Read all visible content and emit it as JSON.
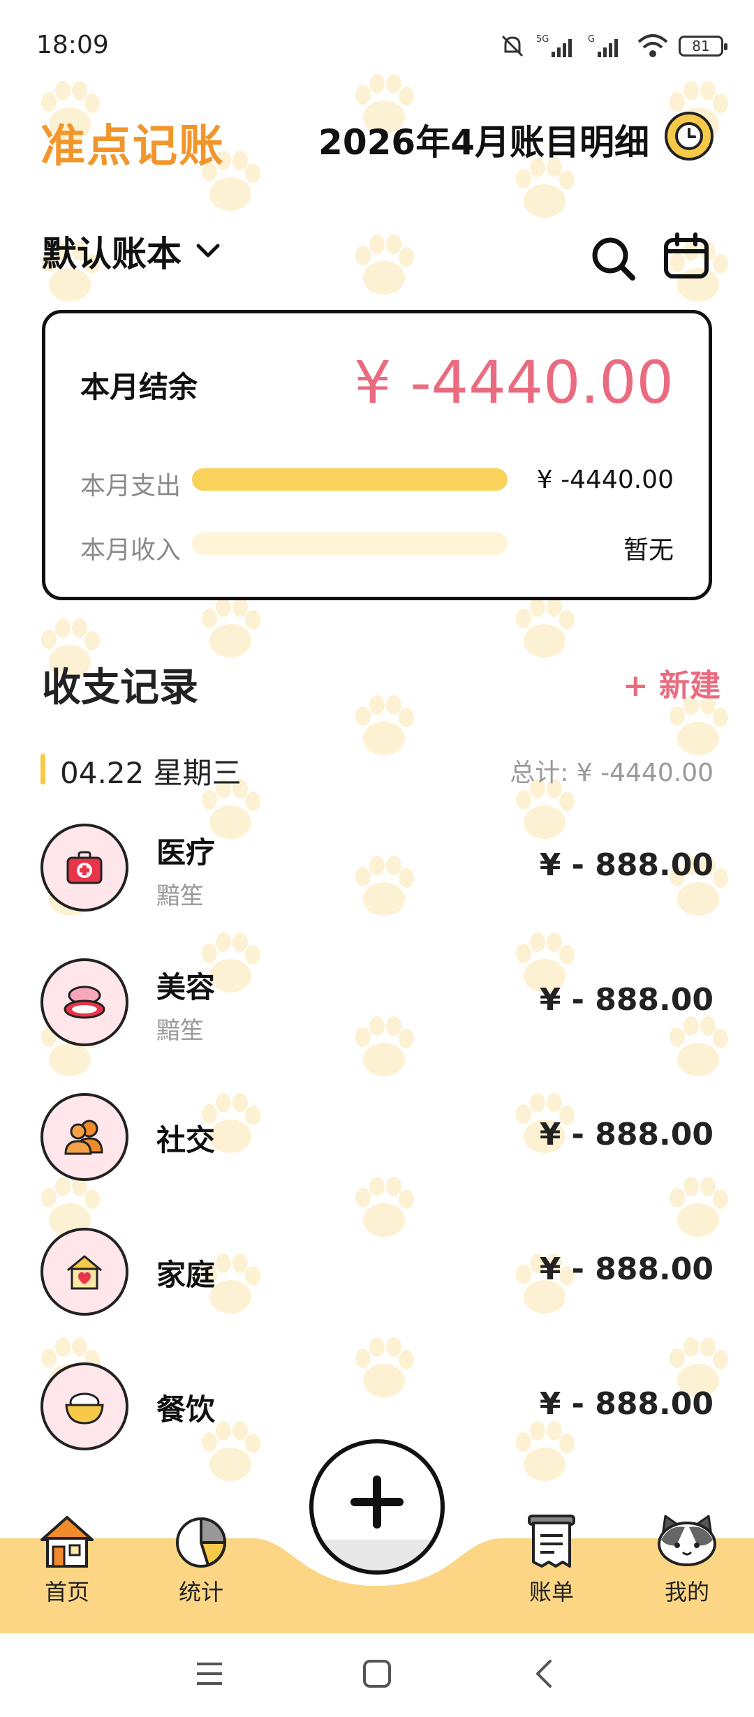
{
  "status_bar": {
    "time": "18:09",
    "battery": "81"
  },
  "header": {
    "app_title": "准点记账",
    "month_title": "2026年4月账目明细"
  },
  "book": {
    "name": "默认账本"
  },
  "summary": {
    "balance_label": "本月结余",
    "balance_value": "¥ -4440.00",
    "expense_label": "本月支出",
    "expense_value": "¥ -4440.00",
    "expense_ratio": 1.0,
    "income_label": "本月收入",
    "income_value": "暂无",
    "income_ratio": 0.0
  },
  "records": {
    "title": "收支记录",
    "new_label": "+ 新建",
    "date": "04.22 星期三",
    "day_total": "总计: ¥ -4440.00",
    "items": [
      {
        "category": "医疗",
        "note": "黯笙",
        "amount": "¥ - 888.00",
        "icon": "medical-kit-icon"
      },
      {
        "category": "美容",
        "note": "黯笙",
        "amount": "¥ - 888.00",
        "icon": "compact-mirror-icon"
      },
      {
        "category": "社交",
        "note": "",
        "amount": "¥ - 888.00",
        "icon": "people-icon"
      },
      {
        "category": "家庭",
        "note": "",
        "amount": "¥ - 888.00",
        "icon": "house-heart-icon"
      },
      {
        "category": "餐饮",
        "note": "",
        "amount": "¥ - 888.00",
        "icon": "rice-bowl-icon"
      }
    ]
  },
  "nav": {
    "home": "首页",
    "stats": "统计",
    "bills": "账单",
    "mine": "我的"
  },
  "colors": {
    "brand": "#f2952b",
    "accent": "#ea6b80",
    "bar": "#f8d25a",
    "nav_bg": "#fcd684"
  }
}
